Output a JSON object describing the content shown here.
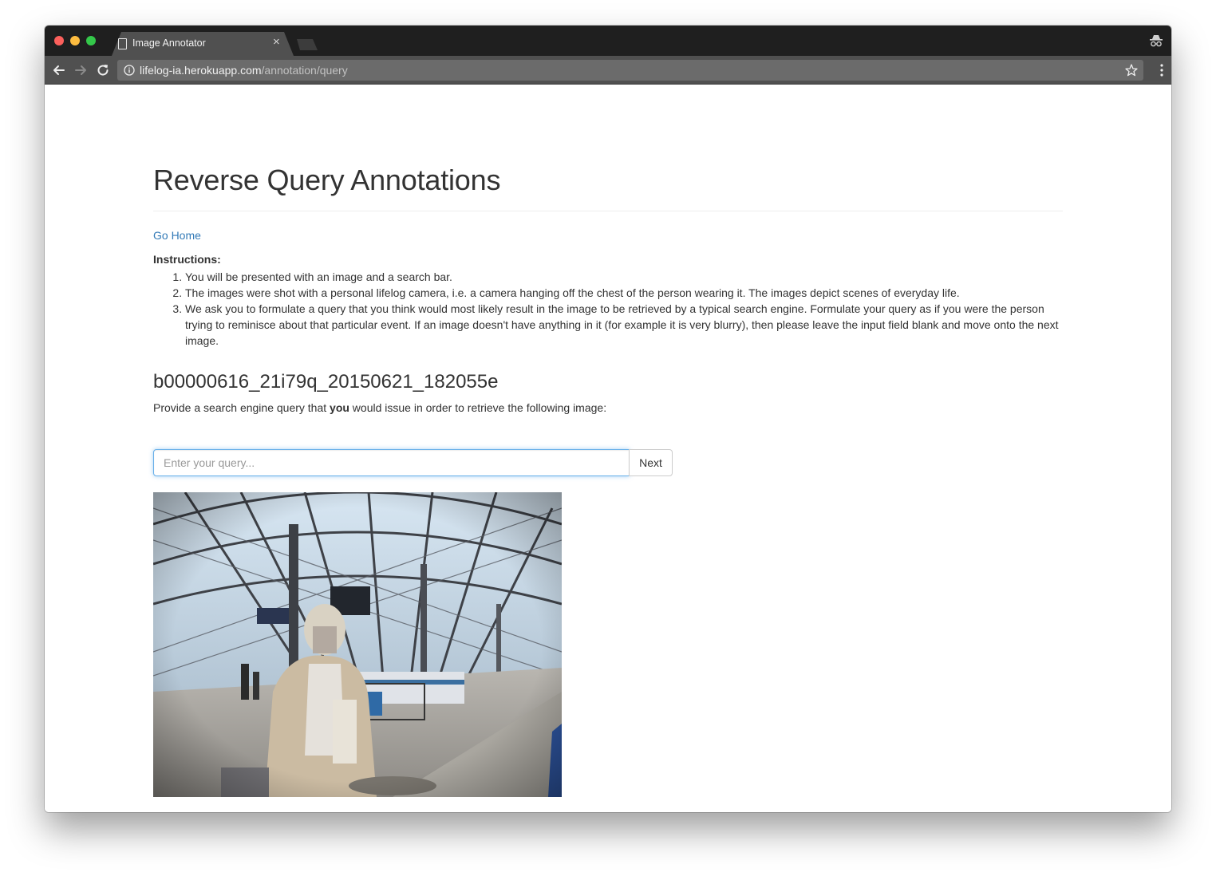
{
  "browser": {
    "tab_title": "Image Annotator",
    "tab_close": "×",
    "url_host": "lifelog-ia.herokuapp.com",
    "url_path": "/annotation/query"
  },
  "page": {
    "heading": "Reverse Query Annotations",
    "go_home": "Go Home",
    "instructions_label": "Instructions:",
    "instructions": [
      "You will be presented with an image and a search bar.",
      "The images were shot with a personal lifelog camera, i.e. a camera hanging off the chest of the person wearing it. The images depict scenes of everyday life.",
      "We ask you to formulate a query that you think would most likely result in the image to be retrieved by a typical search engine. Formulate your query as if you were the person trying to reminisce about that particular event. If an image doesn't have anything in it (for example it is very blurry), then please leave the input field blank and move onto the next image."
    ],
    "image_id": "b00000616_21i79q_20150621_182055e",
    "prompt_before": "Provide a search engine query that ",
    "prompt_bold": "you",
    "prompt_after": " would issue in order to retrieve the following image:",
    "query_placeholder": "Enter your query...",
    "query_value": "",
    "next_label": "Next"
  },
  "colors": {
    "link": "#337ab7",
    "text": "#333333",
    "input_focus": "#66afe9",
    "tab_strip": "#1f1f1f",
    "toolbar": "#505050"
  },
  "icons": [
    "document-icon",
    "close-icon",
    "incognito-icon",
    "back-arrow-icon",
    "forward-arrow-icon",
    "reload-icon",
    "info-icon",
    "star-icon",
    "more-vert-icon"
  ]
}
